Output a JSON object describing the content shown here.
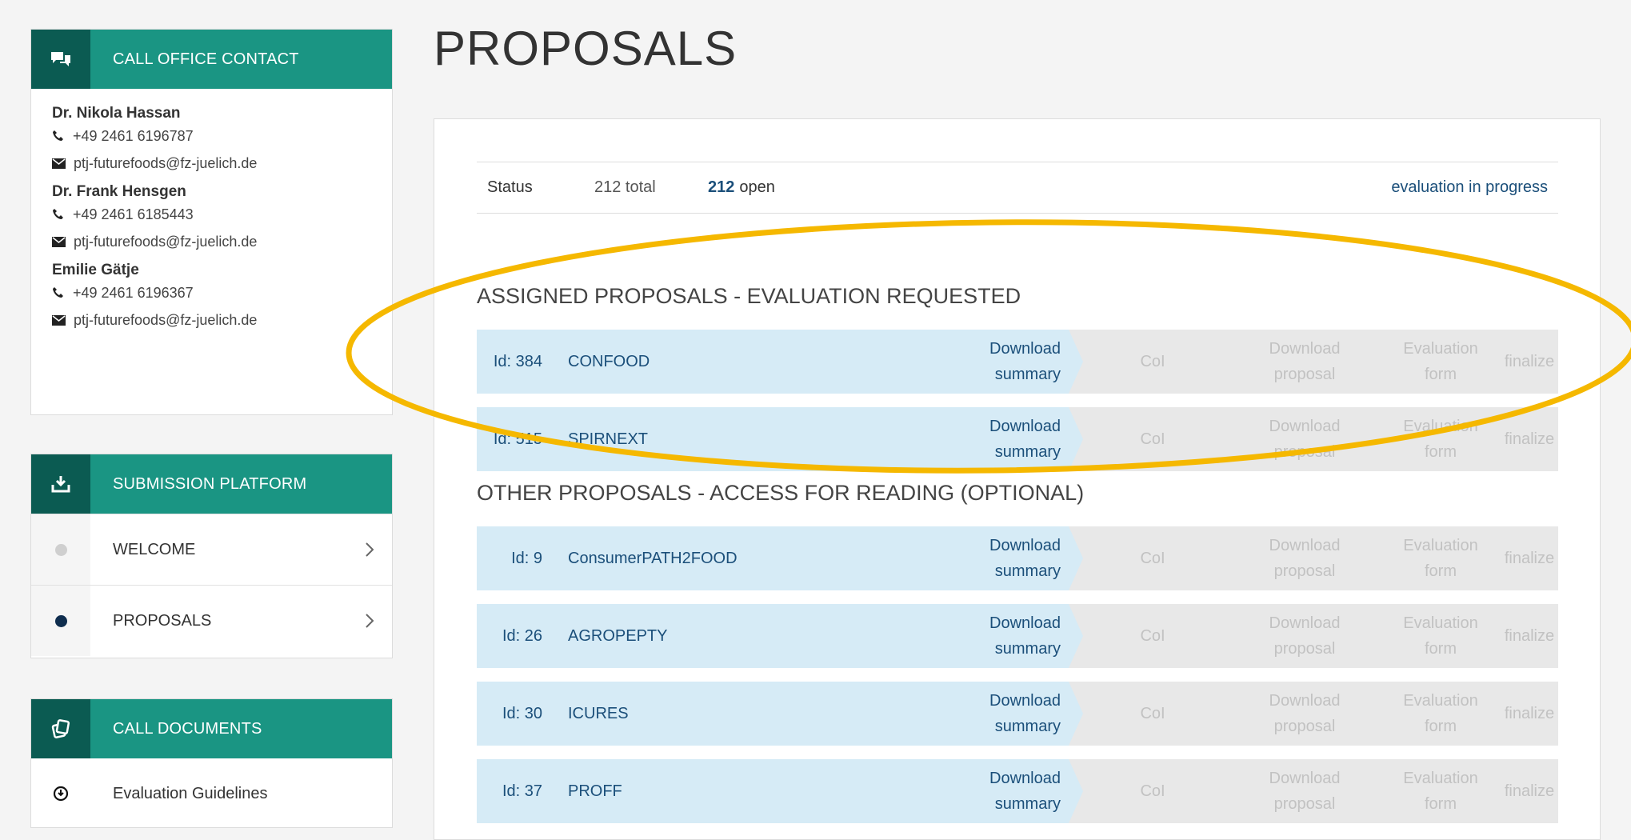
{
  "sidebar": {
    "contact": {
      "title": "CALL OFFICE CONTACT",
      "people": [
        {
          "name": "Dr. Nikola Hassan",
          "phone": "+49 2461 6196787",
          "email": "ptj-futurefoods@fz-juelich.de"
        },
        {
          "name": "Dr. Frank Hensgen",
          "phone": "+49 2461 6185443",
          "email": "ptj-futurefoods@fz-juelich.de"
        },
        {
          "name": "Emilie Gätje",
          "phone": "+49 2461 6196367",
          "email": "ptj-futurefoods@fz-juelich.de"
        }
      ]
    },
    "submission": {
      "title": "SUBMISSION PLATFORM",
      "items": [
        {
          "label": "WELCOME",
          "active": false
        },
        {
          "label": "PROPOSALS",
          "active": true
        }
      ]
    },
    "documents": {
      "title": "CALL DOCUMENTS",
      "items": [
        {
          "label": "Evaluation Guidelines"
        }
      ]
    }
  },
  "main": {
    "title": "PROPOSALS",
    "status": {
      "label": "Status",
      "total": "212 total",
      "open_count": "212",
      "open_label": "open",
      "state": "evaluation in progress"
    },
    "assigned": {
      "title": "ASSIGNED PROPOSALS - EVALUATION REQUESTED",
      "rows": [
        {
          "id": "Id: 384",
          "name": "CONFOOD"
        },
        {
          "id": "Id: 515",
          "name": "SPIRNEXT"
        }
      ]
    },
    "other": {
      "title": "OTHER PROPOSALS - ACCESS FOR READING (OPTIONAL)",
      "rows": [
        {
          "id": "Id: 9",
          "name": "ConsumerPATH2FOOD"
        },
        {
          "id": "Id: 26",
          "name": "AGROPEPTY"
        },
        {
          "id": "Id: 30",
          "name": "ICURES"
        },
        {
          "id": "Id: 37",
          "name": "PROFF"
        }
      ]
    },
    "row_actions": {
      "download_summary": [
        "Download",
        "summary"
      ],
      "coi": "CoI",
      "download_proposal": [
        "Download",
        "proposal"
      ],
      "evaluation_form": [
        "Evaluation",
        "form"
      ],
      "finalize": "finalize"
    }
  },
  "colors": {
    "teal": "#1a9583",
    "teal_dark": "#0b5b52",
    "link_blue": "#1b4f7a",
    "row_blue": "#d6ebf6",
    "row_grey": "#e8e8e8",
    "disabled_text": "#c2c2c2",
    "highlight": "#f5b800"
  },
  "icons": {
    "contact": "chat-bubbles-icon",
    "submission": "download-tray-icon",
    "documents": "documents-icon",
    "phone": "phone-icon",
    "email": "envelope-icon",
    "nav_chevron": "chevron-right-icon",
    "doc_bullet": "circle-arrow-down-icon"
  }
}
